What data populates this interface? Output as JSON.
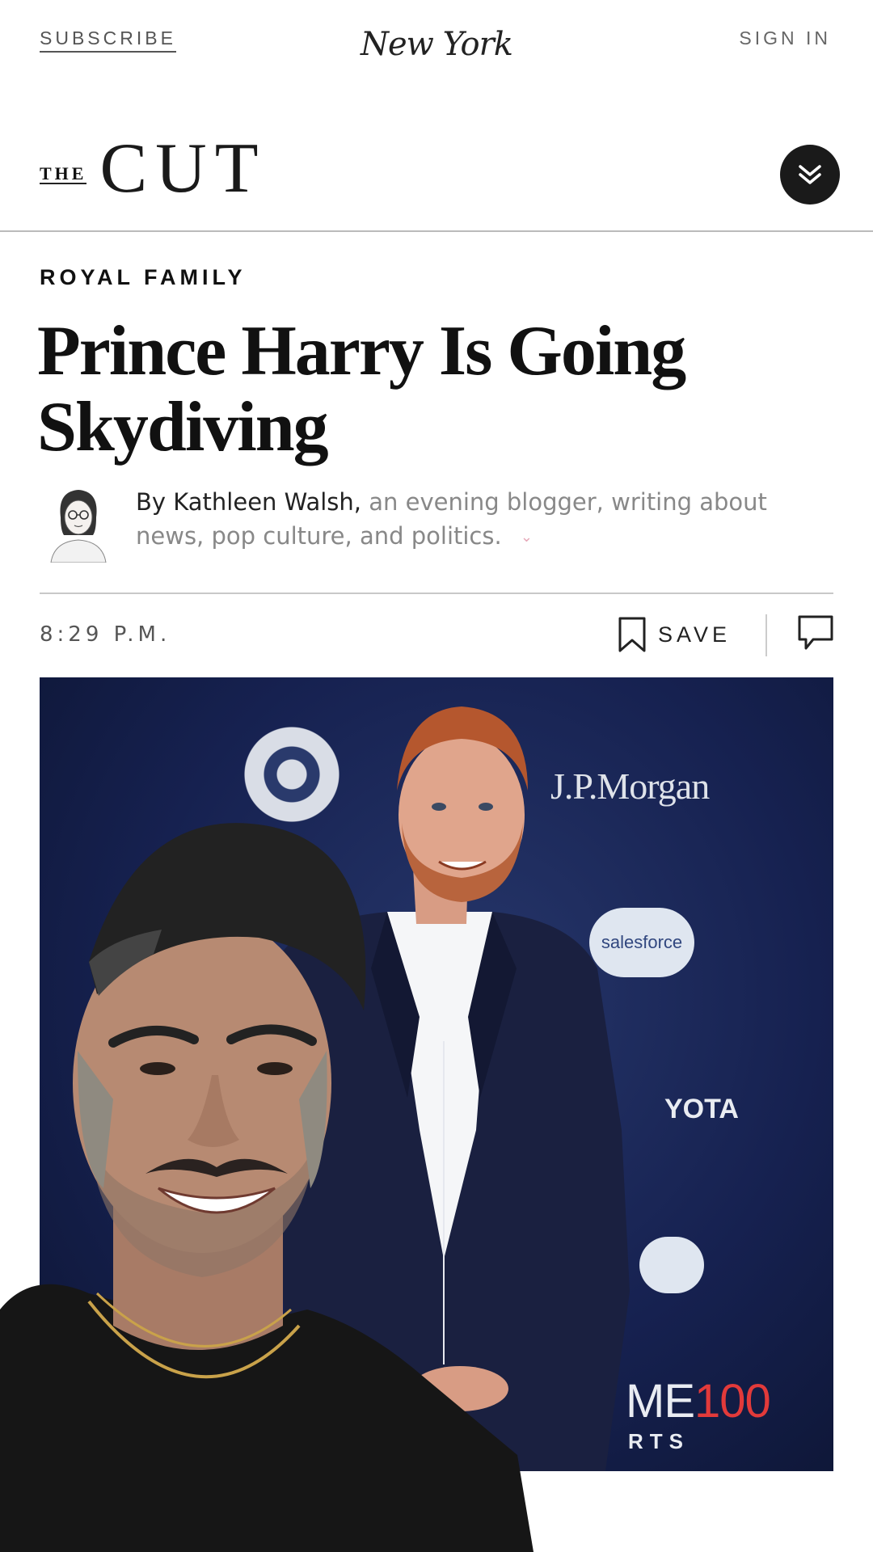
{
  "header": {
    "subscribe_label": "SUBSCRIBE",
    "logo_text": "New York",
    "signin_label": "SIGN IN"
  },
  "section": {
    "logo_the": "THE",
    "logo_cut": "CUT",
    "menu_icon": "double-chevron-down-icon"
  },
  "article": {
    "rubric": "ROYAL FAMILY",
    "headline_line1": "Prince Harry Is Going",
    "headline_line2": "Skydiving",
    "byline_by": "By",
    "author_name": "Kathleen Walsh,",
    "author_bio": "an evening blogger, writing about news, pop culture, and politics.",
    "timestamp": "8:29 P.M.",
    "save_label": "SAVE"
  },
  "hero_image": {
    "sponsor_jpm": "J.P.Morgan",
    "sponsor_salesforce": "salesforce",
    "sponsor_toyota": "YOTA",
    "sponsor_time_text": "ME",
    "sponsor_time_num": "100",
    "sponsor_sports": "RTS"
  },
  "colors": {
    "text_primary": "#111111",
    "text_muted": "#888888",
    "hero_background": "#162150",
    "accent_chevron": "#e6a8b8"
  }
}
